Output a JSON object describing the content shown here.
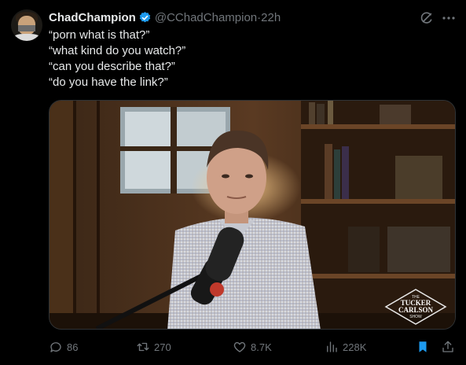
{
  "tweet": {
    "author_name": "ChadChampion",
    "handle": "@CChadChampion",
    "separator": " · ",
    "time": "22h",
    "lines": [
      "“porn what is that?”",
      "“what kind do you watch?”",
      "“can you describe that?”",
      "“do you have the link?”"
    ],
    "media": {
      "watermark_small": "THE",
      "watermark_line1": "TUCKER",
      "watermark_line2": "CARLSON",
      "watermark_small2": "SHOW"
    },
    "stats": {
      "replies": "86",
      "retweets": "270",
      "likes": "8.7K",
      "views": "228K"
    }
  },
  "colors": {
    "background": "#000000",
    "text_primary": "#e7e9ea",
    "text_secondary": "#71767b",
    "verified_blue": "#1d9bf0",
    "bookmark_blue": "#1d9bf0"
  },
  "icons": [
    "verified-badge-icon",
    "grok-icon",
    "more-icon",
    "reply-icon",
    "retweet-icon",
    "like-icon",
    "views-icon",
    "bookmark-icon",
    "share-icon"
  ]
}
